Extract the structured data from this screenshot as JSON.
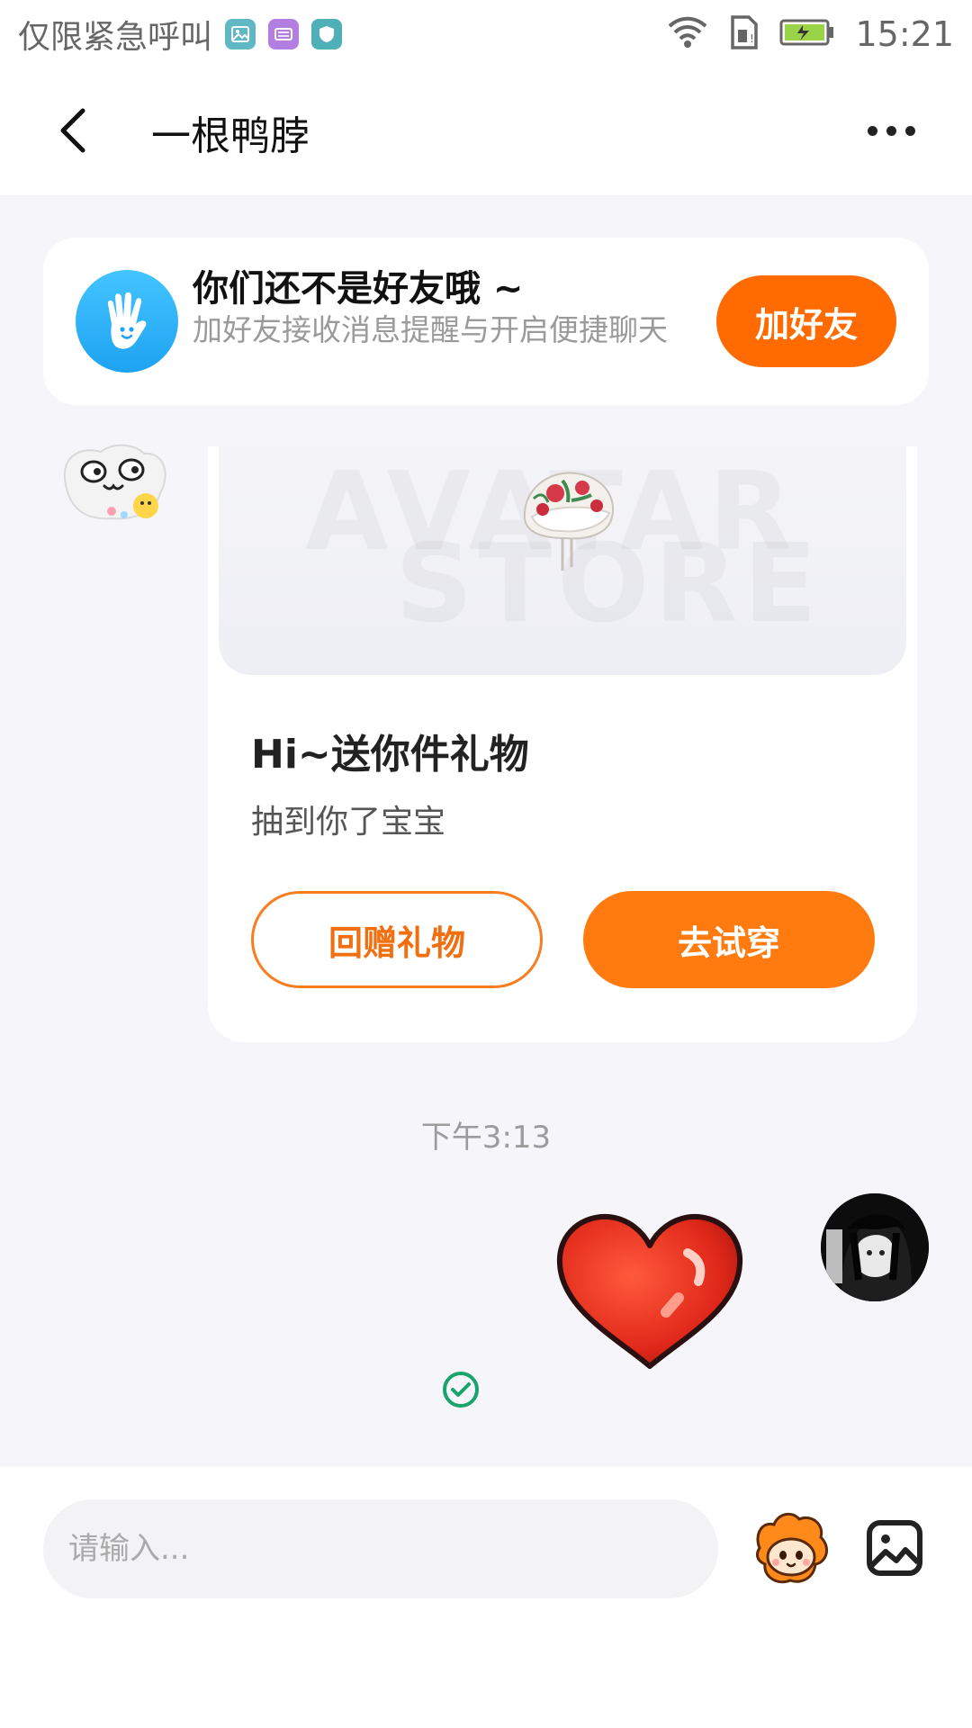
{
  "status_bar": {
    "carrier": "仅限紧急呼叫",
    "time": "15:21",
    "notifications": [
      {
        "icon": "gallery-notif-icon",
        "color": "#5fb8c4"
      },
      {
        "icon": "keyboard-notif-icon",
        "color": "#b27ee0"
      },
      {
        "icon": "shield-notif-icon",
        "color": "#4fb0b8"
      }
    ]
  },
  "header": {
    "title": "一根鸭脖",
    "back_icon": "chevron-left-icon",
    "more_icon": "more-dots-icon"
  },
  "friend_banner": {
    "title": "你们还不是好友哦 ~",
    "subtitle": "加好友接收消息提醒与开启便捷聊天",
    "button": "加好友",
    "accent": "#ff6b00"
  },
  "gift_card": {
    "watermark_line1": "AVATAR",
    "watermark_line2": "STORE",
    "title": "Hi~送你件礼物",
    "description": "抽到你了宝宝",
    "return_button": "回赠礼物",
    "try_button": "去试穿"
  },
  "timestamp": "下午3:13",
  "input": {
    "placeholder": "请输入..."
  },
  "colors": {
    "orange": "#ff7a0f",
    "read_check": "#1aa36b"
  }
}
